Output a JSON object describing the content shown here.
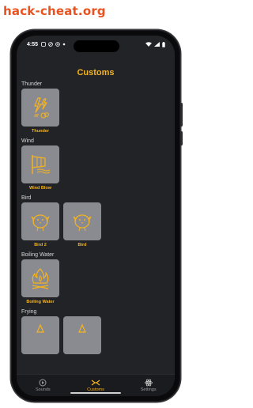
{
  "watermark": "hack-cheat.org",
  "status": {
    "time": "4:55"
  },
  "page": {
    "title": "Customs"
  },
  "sections": [
    {
      "label": "Thunder",
      "items": [
        {
          "label": "Thunder",
          "icon": "thunder-icon"
        }
      ]
    },
    {
      "label": "Wind",
      "items": [
        {
          "label": "Wind Blow",
          "icon": "wind-icon"
        }
      ]
    },
    {
      "label": "Bird",
      "items": [
        {
          "label": "Bird 2",
          "icon": "bird-icon"
        },
        {
          "label": "Bird",
          "icon": "bird-icon"
        }
      ]
    },
    {
      "label": "Boiling Water",
      "items": [
        {
          "label": "Boiling Water",
          "icon": "fire-icon"
        }
      ]
    },
    {
      "label": "Frying",
      "items": [
        {
          "label": "",
          "icon": "frying-icon"
        },
        {
          "label": "",
          "icon": "frying-icon"
        }
      ]
    }
  ],
  "tabs": [
    {
      "label": "Sounds",
      "icon": "sounds-icon"
    },
    {
      "label": "Customs",
      "icon": "customs-icon",
      "active": true
    },
    {
      "label": "Settings",
      "icon": "settings-icon"
    }
  ],
  "colors": {
    "accent": "#f5b320",
    "tile": "#8a8b90",
    "background": "#222327"
  }
}
